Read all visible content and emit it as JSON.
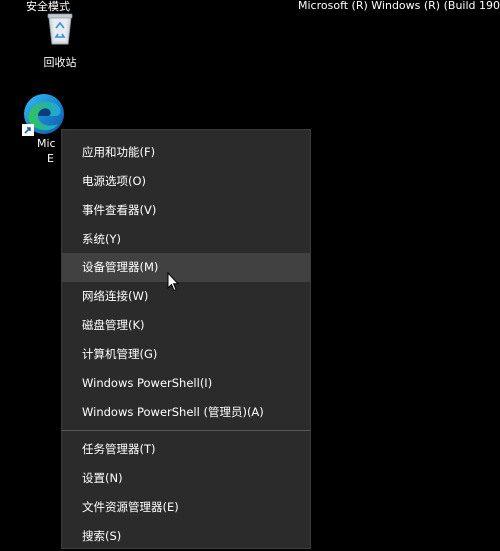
{
  "desktop": {
    "safe_mode_label": "安全模式",
    "watermark": "Microsoft (R) Windows (R) (Build 190",
    "recycle_bin_label": "回收站",
    "edge_label_line1": "Mic",
    "edge_label_line2": "E"
  },
  "context_menu": {
    "items": [
      {
        "label": "应用和功能(F)"
      },
      {
        "label": "电源选项(O)"
      },
      {
        "label": "事件查看器(V)"
      },
      {
        "label": "系统(Y)"
      },
      {
        "label": "设备管理器(M)"
      },
      {
        "label": "网络连接(W)"
      },
      {
        "label": "磁盘管理(K)"
      },
      {
        "label": "计算机管理(G)"
      },
      {
        "label": "Windows PowerShell(I)"
      },
      {
        "label": "Windows PowerShell (管理员)(A)"
      },
      {
        "label": "任务管理器(T)"
      },
      {
        "label": "设置(N)"
      },
      {
        "label": "文件资源管理器(E)"
      },
      {
        "label": "搜索(S)"
      }
    ],
    "highlighted_item": "设备管理器(M)"
  },
  "colors": {
    "desktop_background": "#000000",
    "menu_background": "#2b2b2b",
    "menu_highlight": "#414141",
    "edge_blue": "#0c59a4",
    "edge_green": "#31c453"
  }
}
